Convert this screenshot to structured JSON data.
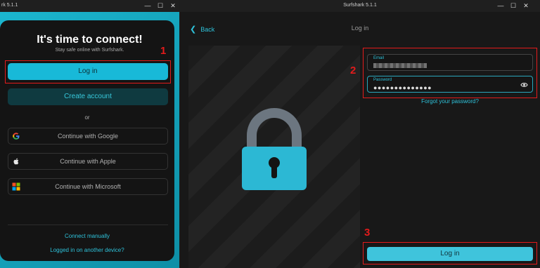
{
  "left_window": {
    "title": "rk 5.1.1",
    "minimize": "—",
    "maximize": "☐",
    "close": "✕",
    "heading": "It's time to connect!",
    "subheading": "Stay safe online with Surfshark.",
    "login_label": "Log in",
    "create_account_label": "Create account",
    "or_label": "or",
    "google_label": "Continue with Google",
    "apple_label": "Continue with Apple",
    "microsoft_label": "Continue with Microsoft",
    "connect_manually_label": "Connect manually",
    "other_device_label": "Logged in on another device?",
    "annotation_1": "1"
  },
  "right_window": {
    "title": "Surfshark 5.1.1",
    "minimize": "—",
    "maximize": "☐",
    "close": "✕",
    "back_label": "Back",
    "page_title": "Log in",
    "email_label": "Email",
    "password_label": "Password",
    "password_value": "●●●●●●●●●●●●●●",
    "forgot_label": "Forgot your password?",
    "login_label": "Log in",
    "annotation_2": "2",
    "annotation_3": "3"
  },
  "colors": {
    "accent": "#18b9d8",
    "annotation_red": "#e31b1b",
    "lock_body": "#2cb8d4",
    "lock_shackle": "#6c7680"
  },
  "icons": [
    "google-icon",
    "apple-icon",
    "microsoft-icon",
    "eye-icon",
    "lock-icon",
    "chevron-left-icon"
  ]
}
